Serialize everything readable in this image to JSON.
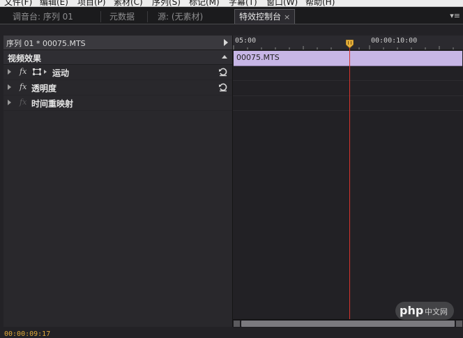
{
  "menubar": {
    "items": [
      "文件(F)",
      "编辑(E)",
      "项目(P)",
      "素材(C)",
      "序列(S)",
      "标记(M)",
      "字幕(T)",
      "窗口(W)",
      "帮助(H)"
    ]
  },
  "tabs": {
    "items": [
      {
        "label": "调音台: 序列 01"
      },
      {
        "label": "元数据"
      },
      {
        "label": "源: (无素材)"
      },
      {
        "label": "特效控制台",
        "active": true,
        "close": "×"
      }
    ],
    "panel_menu": "▾≡"
  },
  "left_panel": {
    "sequence_label": "序列 01 * 00075.MTS",
    "section_title": "视频效果",
    "effects": [
      {
        "fx": "fx",
        "name": "运动",
        "has_reset": true
      },
      {
        "fx": "fx",
        "name": "透明度",
        "has_reset": true
      },
      {
        "fx": "fx",
        "name": "时间重映射",
        "has_reset": false
      }
    ]
  },
  "timeline": {
    "ruler_left": "05:00",
    "ruler_right": "00:00:10:00",
    "clip_label": "00075.MTS",
    "clip_color": "#c7b6e6",
    "playhead_color": "#d8332d"
  },
  "footer": {
    "timecode": "00:00:09:17"
  },
  "watermark": {
    "text": "php",
    "subtext": "中文网"
  }
}
